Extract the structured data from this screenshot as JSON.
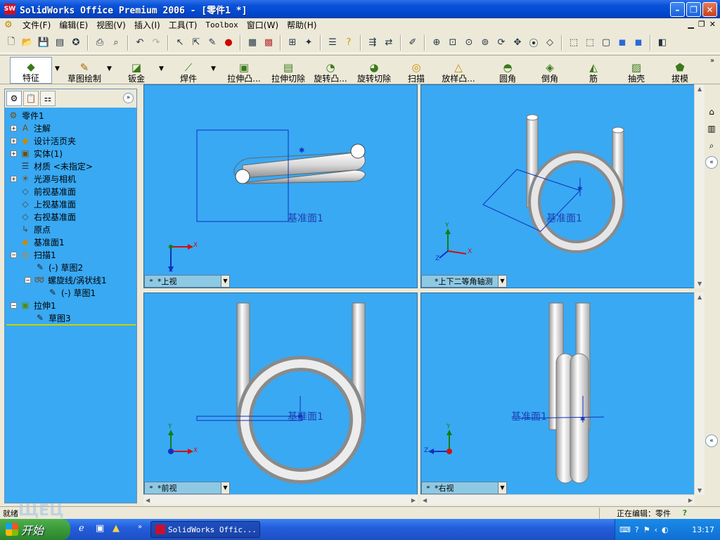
{
  "window": {
    "title": "SolidWorks Office Premium 2006 - [零件1 *]",
    "app_icon": "SW"
  },
  "menu": {
    "items": [
      "文件(F)",
      "编辑(E)",
      "视图(V)",
      "插入(I)",
      "工具(T)",
      "Toolbox",
      "窗口(W)",
      "帮助(H)"
    ]
  },
  "feature_toolbar": {
    "buttons": [
      "特征",
      "草图绘制",
      "钣金",
      "焊件",
      "拉伸凸...",
      "拉伸切除",
      "旋转凸...",
      "旋转切除",
      "扫描",
      "放样凸...",
      "圆角",
      "倒角",
      "筋",
      "抽壳",
      "拔模"
    ]
  },
  "feature_tree": {
    "items": [
      {
        "label": "零件1",
        "icon": "part-icon"
      },
      {
        "label": "注解",
        "icon": "annotation-icon"
      },
      {
        "label": "设计活页夹",
        "icon": "design-binder-icon"
      },
      {
        "label": "实体(1)",
        "icon": "solid-bodies-icon"
      },
      {
        "label": "材质 <未指定>",
        "icon": "material-icon"
      },
      {
        "label": "光源与相机",
        "icon": "lights-cameras-icon"
      },
      {
        "label": "前视基准面",
        "icon": "plane-icon"
      },
      {
        "label": "上视基准面",
        "icon": "plane-icon"
      },
      {
        "label": "右视基准面",
        "icon": "plane-icon"
      },
      {
        "label": "原点",
        "icon": "origin-icon"
      },
      {
        "label": "基准面1",
        "icon": "plane-icon"
      },
      {
        "label": "扫描1",
        "icon": "sweep-icon"
      },
      {
        "label": "(-) 草图2",
        "icon": "sketch-icon"
      },
      {
        "label": "螺旋线/涡状线1",
        "icon": "helix-icon"
      },
      {
        "label": "(-) 草图1",
        "icon": "sketch-icon"
      },
      {
        "label": "拉伸1",
        "icon": "extrude-icon"
      },
      {
        "label": "草图3",
        "icon": "sketch-icon"
      }
    ]
  },
  "viewports": {
    "top": {
      "name": "*上视",
      "plane_label": "基准面1"
    },
    "iso": {
      "name": "*上下二等角轴测",
      "plane_label": "基准面1"
    },
    "front": {
      "name": "*前视",
      "plane_label": "基准面1"
    },
    "right": {
      "name": "*右视",
      "plane_label": "基准面1"
    }
  },
  "axes": {
    "x": "X",
    "y": "Y",
    "z": "Z"
  },
  "status": {
    "left": "就绪",
    "right": "正在编辑：零件"
  },
  "watermark": "ЩЕЦ",
  "taskbar": {
    "start": "开始",
    "task_button": "SolidWorks Offic...",
    "clock": "13:17"
  },
  "colors": {
    "viewport_bg": "#39a9f3",
    "plane_blue": "#1f3fb0",
    "axis_red": "#d01010",
    "axis_green": "#108010",
    "axis_blue": "#1030c0"
  }
}
